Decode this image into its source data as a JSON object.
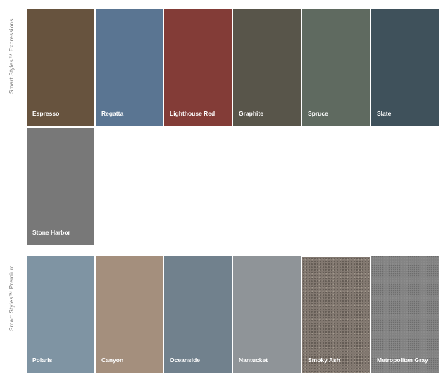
{
  "sections": {
    "expressions_label": "Smart Styles™ Expressions",
    "premium_label": "Smart Styles™ Premium"
  },
  "swatches": {
    "espresso": {
      "name": "Espresso",
      "color": "#67533e"
    },
    "regatta": {
      "name": "Regatta",
      "color": "#5a7592"
    },
    "lighthouse_red": {
      "name": "Lighthouse Red",
      "color": "#833c37"
    },
    "graphite": {
      "name": "Graphite",
      "color": "#58554a"
    },
    "spruce": {
      "name": "Spruce",
      "color": "#5f6a60"
    },
    "slate": {
      "name": "Slate",
      "color": "#3f515b"
    },
    "stone_harbor": {
      "name": "Stone Harbor",
      "color": "#787878"
    },
    "polaris": {
      "name": "Polaris",
      "color": "#7f94a3"
    },
    "canyon": {
      "name": "Canyon",
      "color": "#a48f7d"
    },
    "oceanside": {
      "name": "Oceanside",
      "color": "#71818d"
    },
    "nantucket": {
      "name": "Nantucket",
      "color": "#8f9498"
    },
    "smoky_ash": {
      "name": "Smoky Ash",
      "color": "#827870"
    },
    "metropolitan_gray": {
      "name": "Metropolitan Gray",
      "color": "#858585"
    }
  }
}
